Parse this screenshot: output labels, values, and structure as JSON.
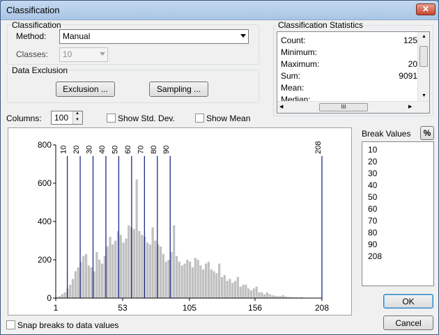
{
  "window": {
    "title": "Classification"
  },
  "classification": {
    "group_label": "Classification",
    "method_label": "Method:",
    "method_value": "Manual",
    "classes_label": "Classes:",
    "classes_value": "10"
  },
  "exclusion": {
    "group_label": "Data Exclusion",
    "exclusion_button": "Exclusion ...",
    "sampling_button": "Sampling ..."
  },
  "stats": {
    "group_label": "Classification Statistics",
    "rows": [
      {
        "label": "Count:",
        "value": "125"
      },
      {
        "label": "Minimum:",
        "value": ""
      },
      {
        "label": "Maximum:",
        "value": "20"
      },
      {
        "label": "Sum:",
        "value": "9091"
      },
      {
        "label": "Mean:",
        "value": ""
      },
      {
        "label": "Median:",
        "value": ""
      }
    ],
    "hscroll_thumb": "III"
  },
  "columns": {
    "label": "Columns:",
    "value": "100"
  },
  "options": {
    "show_std_dev": "Show Std. Dev.",
    "show_mean": "Show Mean",
    "snap": "Snap breaks to data values"
  },
  "breaks": {
    "label": "Break Values",
    "percent_button": "%",
    "values": [
      "10",
      "20",
      "30",
      "40",
      "50",
      "60",
      "70",
      "80",
      "90",
      "208"
    ]
  },
  "buttons": {
    "ok": "OK",
    "cancel": "Cancel"
  },
  "chart_data": {
    "type": "bar",
    "title": "",
    "xlabel": "",
    "ylabel": "",
    "xlim": [
      1,
      208
    ],
    "ylim": [
      0,
      800
    ],
    "x_ticks": [
      "1",
      "53",
      "105",
      "156",
      "208"
    ],
    "y_ticks": [
      "0",
      "200",
      "400",
      "600",
      "800"
    ],
    "bin_width": 2.07,
    "values": [
      5,
      10,
      20,
      30,
      50,
      70,
      100,
      140,
      160,
      190,
      220,
      230,
      170,
      160,
      140,
      240,
      200,
      180,
      220,
      270,
      320,
      280,
      300,
      350,
      330,
      290,
      310,
      380,
      370,
      360,
      620,
      350,
      330,
      320,
      290,
      280,
      370,
      300,
      280,
      270,
      230,
      190,
      200,
      240,
      380,
      220,
      190,
      170,
      180,
      200,
      190,
      160,
      210,
      200,
      170,
      150,
      180,
      190,
      150,
      140,
      130,
      180,
      110,
      120,
      90,
      100,
      80,
      90,
      110,
      60,
      70,
      70,
      50,
      40,
      50,
      60,
      30,
      30,
      20,
      30,
      20,
      15,
      12,
      10,
      10,
      15,
      8,
      6,
      5,
      4,
      5,
      3,
      4,
      3,
      2,
      2,
      1,
      1,
      1,
      0
    ],
    "break_lines": [
      10,
      20,
      30,
      40,
      50,
      60,
      70,
      80,
      90,
      208
    ],
    "colors": {
      "bars": "#c0c0c0",
      "break_lines": "#1c2a8a"
    }
  }
}
